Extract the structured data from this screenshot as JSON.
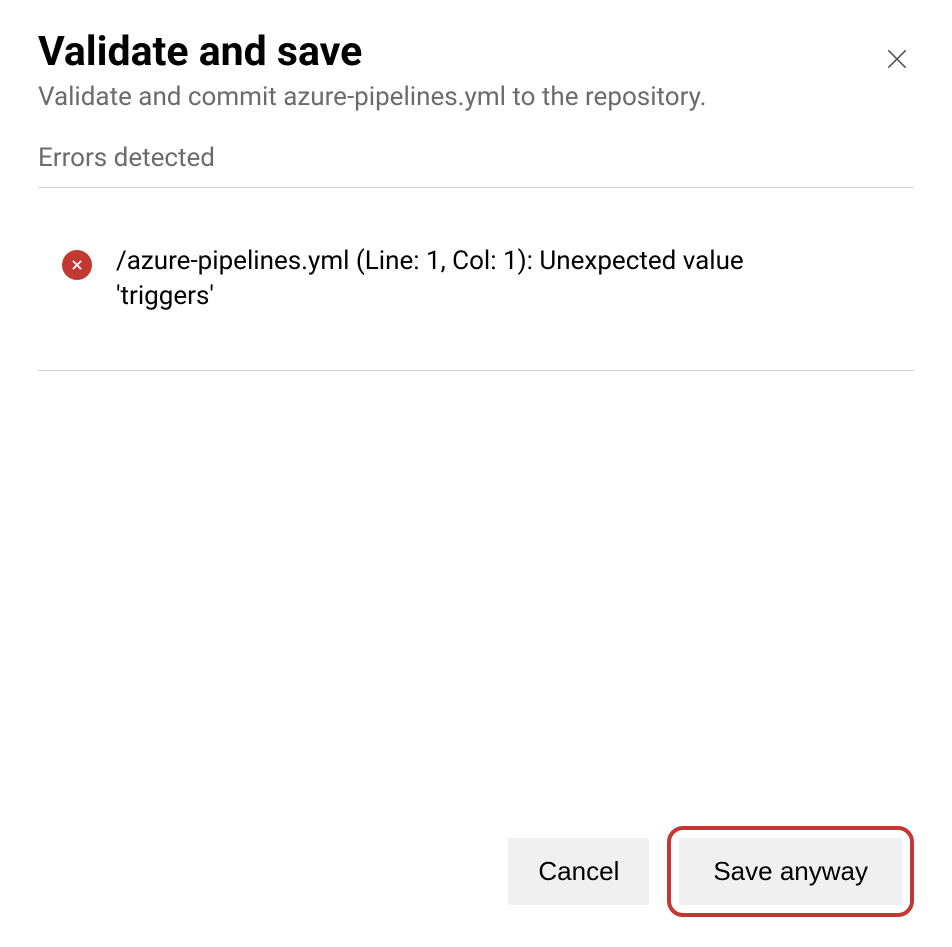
{
  "header": {
    "title": "Validate and save",
    "subtitle": "Validate and commit azure-pipelines.yml to the repository."
  },
  "errors": {
    "section_label": "Errors detected",
    "items": [
      {
        "message": "/azure-pipelines.yml (Line: 1, Col: 1): Unexpected value 'triggers'"
      }
    ]
  },
  "footer": {
    "cancel_label": "Cancel",
    "save_anyway_label": "Save anyway"
  }
}
